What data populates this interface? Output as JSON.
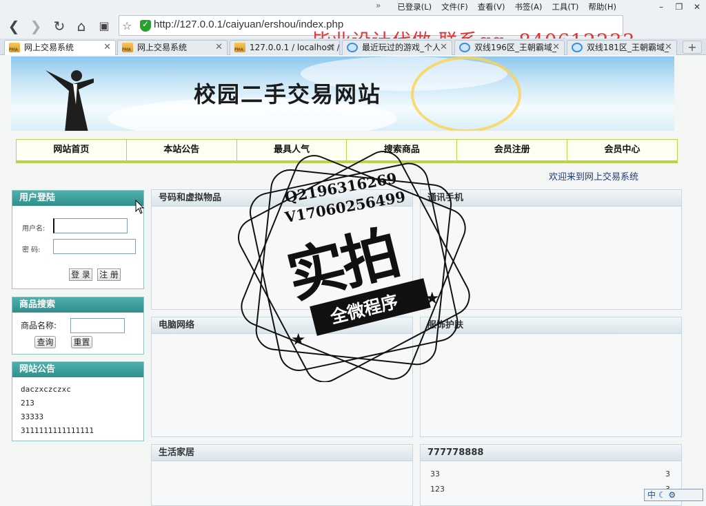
{
  "browser": {
    "overflow_glyph": "»",
    "menus": [
      "已登录(L)",
      "文件(F)",
      "查看(V)",
      "书签(A)",
      "工具(T)",
      "帮助(H)"
    ],
    "url": "http://127.0.0.1/caiyuan/ershou/index.php",
    "promo_overlay": "毕业设计代做 联系qq: 840612233",
    "tabs": [
      {
        "label": "网上交易系统",
        "icon": "pma"
      },
      {
        "label": "网上交易系统",
        "icon": "pma"
      },
      {
        "label": "127.0.0.1 / localhost /",
        "icon": "pma"
      },
      {
        "label": "最近玩过的游戏_个人",
        "icon": "ie"
      },
      {
        "label": "双线196区_王朝霸域_",
        "icon": "ie"
      },
      {
        "label": "双线181区_王朝霸域_",
        "icon": "ie"
      }
    ],
    "new_tab": "+"
  },
  "site": {
    "banner_title": "校园二手交易网站",
    "nav": [
      "网站首页",
      "本站公告",
      "最具人气",
      "搜索商品",
      "会员注册",
      "会员中心"
    ],
    "welcome": "欢迎来到网上交易系统"
  },
  "login": {
    "title": "用户登陆",
    "username_label": "用户名:",
    "password_label": "密  码:",
    "login_button": "登 录",
    "register_button": "注 册"
  },
  "search": {
    "title": "商品搜索",
    "name_label": "商品名称:",
    "query_button": "查询",
    "reset_button": "重置"
  },
  "notices": {
    "title": "网站公告",
    "items": [
      "daczxczczxc",
      "213",
      "33333",
      "3111111111111111"
    ]
  },
  "categories": [
    {
      "title": "号码和虚拟物品"
    },
    {
      "title": "通讯手机"
    },
    {
      "title": "电脑网络"
    },
    {
      "title": "服饰护肤"
    },
    {
      "title": "生活家居"
    },
    {
      "title": "777778888",
      "rows": [
        {
          "name": "33",
          "value": "3"
        },
        {
          "name": "123",
          "value": "3"
        }
      ]
    }
  ],
  "watermark": {
    "contact1": "Q2196316269",
    "contact2": "V17060256499",
    "big": "实拍",
    "small": "全微程序"
  },
  "ime": "中"
}
